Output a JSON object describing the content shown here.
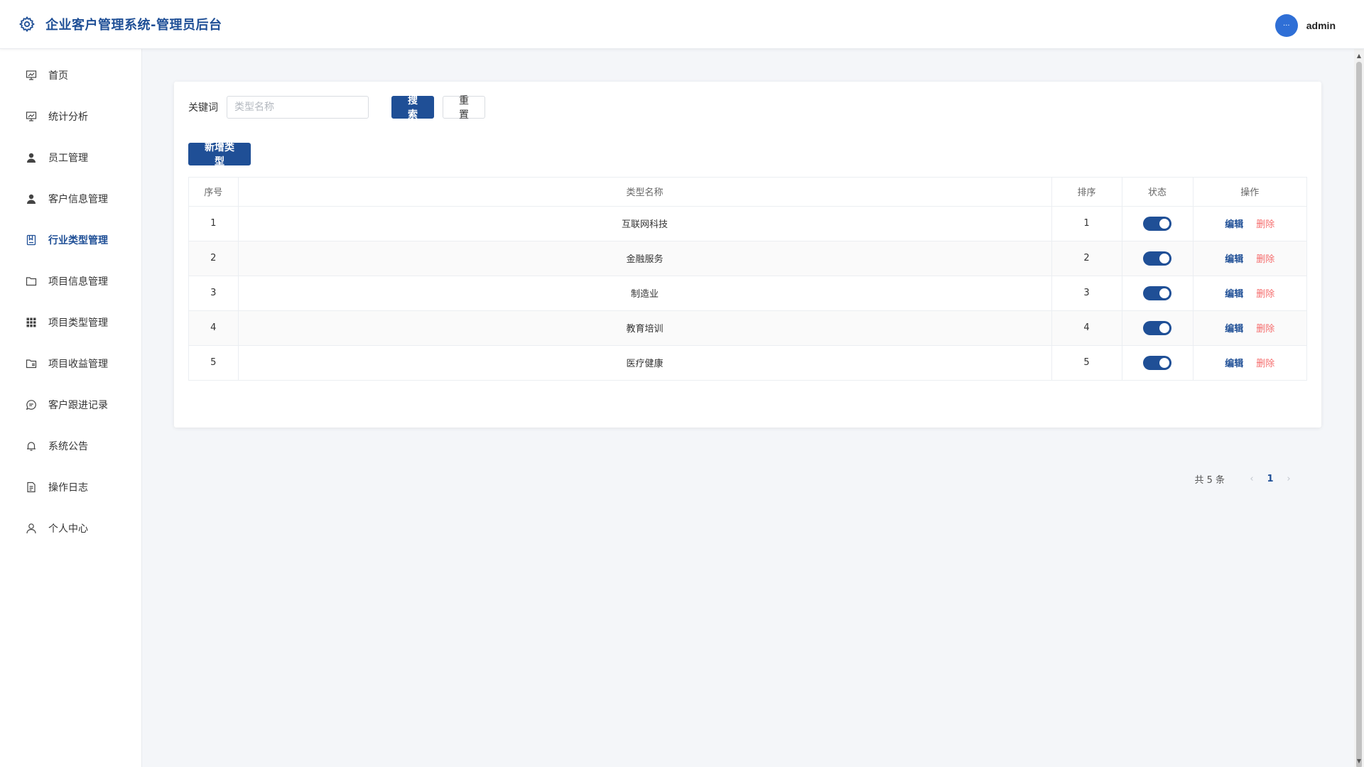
{
  "header": {
    "title": "企业客户管理系统-管理员后台",
    "avatar_text": "···",
    "username": "admin"
  },
  "sidebar": {
    "items": [
      {
        "label": "首页",
        "icon": "presentation-icon",
        "active": false
      },
      {
        "label": "统计分析",
        "icon": "presentation-icon",
        "active": false
      },
      {
        "label": "员工管理",
        "icon": "user-filled-icon",
        "active": false
      },
      {
        "label": "客户信息管理",
        "icon": "user-filled-icon",
        "active": false
      },
      {
        "label": "行业类型管理",
        "icon": "notebook-icon",
        "active": true
      },
      {
        "label": "项目信息管理",
        "icon": "folder-icon",
        "active": false
      },
      {
        "label": "项目类型管理",
        "icon": "grid-icon",
        "active": false
      },
      {
        "label": "项目收益管理",
        "icon": "folder-checked-icon",
        "active": false
      },
      {
        "label": "客户跟进记录",
        "icon": "chat-icon",
        "active": false
      },
      {
        "label": "系统公告",
        "icon": "bell-icon",
        "active": false
      },
      {
        "label": "操作日志",
        "icon": "document-icon",
        "active": false
      },
      {
        "label": "个人中心",
        "icon": "user-icon",
        "active": false
      }
    ]
  },
  "search": {
    "label": "关键词",
    "placeholder": "类型名称",
    "value": "",
    "search_label": "搜索",
    "reset_label": "重置"
  },
  "toolbar": {
    "add_label": "新增类型"
  },
  "table": {
    "headers": [
      "序号",
      "类型名称",
      "排序",
      "状态",
      "操作"
    ],
    "rows": [
      {
        "index": "1",
        "name": "互联网科技",
        "sort": "1",
        "enabled": true
      },
      {
        "index": "2",
        "name": "金融服务",
        "sort": "2",
        "enabled": true
      },
      {
        "index": "3",
        "name": "制造业",
        "sort": "3",
        "enabled": true
      },
      {
        "index": "4",
        "name": "教育培训",
        "sort": "4",
        "enabled": true
      },
      {
        "index": "5",
        "name": "医疗健康",
        "sort": "5",
        "enabled": true
      }
    ],
    "edit_label": "编辑",
    "delete_label": "删除"
  },
  "pagination": {
    "total_text": "共 5 条",
    "prev": "‹",
    "current": "1",
    "next": "›"
  },
  "colors": {
    "primary": "#1f4f96",
    "danger": "#f56c6c",
    "background": "#f4f6f9"
  }
}
